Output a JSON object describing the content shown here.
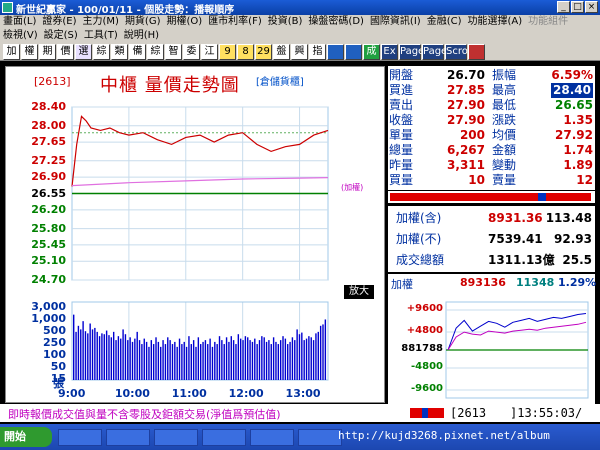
{
  "window": {
    "title": "新世紀贏家 - 100/01/11 - 個股走勢：播報順序",
    "controls": [
      "_",
      "□",
      "×"
    ]
  },
  "menu": {
    "row1": [
      {
        "label": "畫面(L)",
        "enabled": true
      },
      {
        "label": "證券(E)",
        "enabled": true
      },
      {
        "label": "主力(M)",
        "enabled": true
      },
      {
        "label": "期貨(G)",
        "enabled": true
      },
      {
        "label": "期權(O)",
        "enabled": true
      },
      {
        "label": "匯市利率(F)",
        "enabled": true
      },
      {
        "label": "投資(B)",
        "enabled": true
      },
      {
        "label": "操盤密碼(D)",
        "enabled": true
      },
      {
        "label": "國際資訊(I)",
        "enabled": true
      },
      {
        "label": "金融(C)",
        "enabled": true
      },
      {
        "label": "功能選擇(A)",
        "enabled": true
      },
      {
        "label": "功能組件",
        "enabled": false
      }
    ],
    "row2": [
      {
        "label": "檢視(V)",
        "enabled": true
      },
      {
        "label": "設定(S)",
        "enabled": true
      },
      {
        "label": "工具(T)",
        "enabled": true
      },
      {
        "label": "說明(H)",
        "enabled": true
      }
    ]
  },
  "toolbar": [
    "加",
    "權",
    "期",
    "價",
    "選",
    "綜",
    "類",
    "備",
    "綜",
    "智",
    "委",
    "江",
    "9",
    "8",
    "29",
    "盤",
    "興",
    "指",
    "",
    "",
    "成",
    "Ex",
    "Page",
    "Page",
    "Scroll",
    ""
  ],
  "chart": {
    "code": "[2613]",
    "title": "中櫃   量價走勢圖",
    "subtitle": "[倉儲貨櫃]",
    "price_labels": [
      "28.40",
      "28.00",
      "27.65",
      "27.25",
      "26.90",
      "26.55",
      "26.20",
      "25.80",
      "25.45",
      "25.10",
      "24.70"
    ],
    "ref_price": "26.55",
    "volume_labels": [
      "3,000",
      "1,000",
      "500",
      "250",
      "100",
      "50",
      "15"
    ],
    "volume_unit": "張",
    "time_labels": [
      "9:00",
      "10:00",
      "11:00",
      "12:00",
      "13:00"
    ],
    "overlay_label": "(加權)",
    "zoom_tab": "放大"
  },
  "chart_data": [
    {
      "type": "line",
      "name": "price",
      "ylim": [
        24.7,
        28.4
      ],
      "xlim": [
        "9:00",
        "13:30"
      ],
      "xlabels": [
        "9:00",
        "10:00",
        "11:00",
        "12:00",
        "13:00"
      ],
      "series": [
        {
          "name": "成交價",
          "color": "#cc0000",
          "x": [
            "9:00",
            "9:05",
            "9:10",
            "9:15",
            "9:20",
            "9:30",
            "9:40",
            "9:50",
            "10:00",
            "10:15",
            "10:30",
            "10:45",
            "11:00",
            "11:15",
            "11:30",
            "11:45",
            "12:00",
            "12:15",
            "12:30",
            "12:45",
            "13:00",
            "13:15",
            "13:30"
          ],
          "values": [
            26.7,
            27.6,
            28.2,
            28.1,
            27.95,
            27.9,
            27.95,
            27.85,
            27.8,
            27.85,
            27.7,
            27.6,
            27.75,
            27.8,
            27.65,
            27.8,
            27.85,
            27.6,
            27.45,
            27.55,
            27.6,
            27.8,
            27.9
          ]
        },
        {
          "name": "加權",
          "color": "#e070e0",
          "x": [
            "9:00",
            "10:00",
            "11:00",
            "12:00",
            "13:00",
            "13:30"
          ],
          "values": [
            26.72,
            26.78,
            26.82,
            26.86,
            26.88,
            26.89
          ]
        }
      ],
      "reference_lines": [
        {
          "value": 26.55,
          "color": "#008000"
        }
      ]
    },
    {
      "type": "bar",
      "name": "volume",
      "unit": "張",
      "ylabels": [
        "3,000",
        "1,000",
        "500",
        "250",
        "100",
        "50",
        "15"
      ],
      "values": [
        820,
        140,
        260,
        180,
        420,
        150,
        120,
        330,
        180,
        210,
        140,
        90,
        120,
        110,
        160,
        100,
        80,
        140,
        60,
        90,
        70,
        180,
        110,
        60,
        80,
        50,
        70,
        140,
        60,
        40,
        70,
        50,
        30,
        60,
        40,
        80,
        50,
        30,
        60,
        40,
        80,
        60,
        40,
        50,
        30,
        70,
        40,
        50,
        30,
        90,
        40,
        60,
        30,
        80,
        40,
        50,
        60,
        40,
        70,
        30,
        50,
        40,
        90,
        60,
        40,
        80,
        50,
        90,
        60,
        40,
        110,
        70,
        60,
        90,
        80,
        60,
        50,
        70,
        40,
        60,
        90,
        80,
        50,
        60,
        40,
        80,
        50,
        40,
        60,
        90,
        70,
        40,
        50,
        80,
        60,
        180,
        110,
        130,
        60,
        70,
        90,
        80,
        60,
        120,
        140,
        260,
        300,
        500
      ]
    },
    {
      "type": "line",
      "name": "index-mini",
      "ylim": [
        -9600,
        9600
      ],
      "ylabels": [
        "+9600",
        "+4800",
        "8817.88",
        "-4800",
        "-9600"
      ],
      "series": [
        {
          "name": "加權",
          "color": "#0000cc",
          "values": [
            8817,
            9040,
            9120,
            9010,
            9060,
            9110,
            9090,
            9050,
            9100,
            9120,
            9140,
            9110,
            9130,
            9150,
            9140,
            9160,
            9180,
            9190
          ]
        },
        {
          "name": "加權2",
          "color": "#c000c0",
          "values": [
            8817,
            8950,
            9000,
            8980,
            8970,
            9010,
            9000,
            8990,
            9010,
            9020,
            9030,
            9020,
            9040,
            9050,
            9060,
            9070,
            9080,
            9100
          ]
        }
      ]
    }
  ],
  "quote": {
    "rows": [
      {
        "l1": "開盤",
        "v1": "26.70",
        "c1": "#000",
        "l2": "振幅",
        "v2": "6.59%",
        "c2": "#cc0000",
        "hl": false
      },
      {
        "l1": "買進",
        "v1": "27.85",
        "c1": "#cc0000",
        "l2": "最高",
        "v2": "28.40",
        "c2": "#fff",
        "hl": true
      },
      {
        "l1": "賣出",
        "v1": "27.90",
        "c1": "#cc0000",
        "l2": "最低",
        "v2": "26.65",
        "c2": "#008000",
        "hl": false
      },
      {
        "l1": "收盤",
        "v1": "27.90",
        "c1": "#cc0000",
        "l2": "漲跌",
        "v2": "1.35",
        "c2": "#cc0000",
        "hl": false
      },
      {
        "l1": "單量",
        "v1": "200",
        "c1": "#cc0000",
        "l2": "均價",
        "v2": "27.92",
        "c2": "#cc0000",
        "hl": false
      },
      {
        "l1": "總量",
        "v1": "6,267",
        "c1": "#cc0000",
        "l2": "金額",
        "v2": "1.74",
        "c2": "#cc0000",
        "hl": false
      },
      {
        "l1": "昨量",
        "v1": "3,311",
        "c1": "#cc0000",
        "l2": "變動",
        "v2": "1.89",
        "c2": "#cc0000",
        "hl": false
      },
      {
        "l1": "買量",
        "v1": "10",
        "c1": "#cc0000",
        "l2": "賣量",
        "v2": "12",
        "c2": "#cc0000",
        "hl": false
      }
    ]
  },
  "index": {
    "rows": [
      {
        "label": "加權(含)",
        "value": "8931.36",
        "change": "113.48",
        "vcolor": "#cc0000"
      },
      {
        "label": "加權(不)",
        "value": "7539.41",
        "change": "92.93",
        "vcolor": "#000"
      },
      {
        "label": "成交總額",
        "value": "1311.13億",
        "change": "25.5",
        "vcolor": "#000"
      }
    ]
  },
  "mini": {
    "label": "加權",
    "value": "893136",
    "change": "11348",
    "pct": "1.29%",
    "ylabels": [
      "+9600",
      "+4800",
      "881788",
      "-4800",
      "-9600"
    ]
  },
  "status": {
    "notice": "即時報價成交值與量不含零股及鉅額交易(淨值爲預估值)",
    "code": "[2613",
    "time": "]13:55:03/"
  },
  "taskbar": {
    "start": "開始",
    "tasks": [
      "",
      "",
      "",
      "",
      "",
      "",
      ""
    ]
  },
  "watermark": "http://kujd3268.pixnet.net/album",
  "colors": {
    "up": "#cc0000",
    "down": "#008000",
    "label": "#0030a0",
    "accent": "#cc0000"
  }
}
